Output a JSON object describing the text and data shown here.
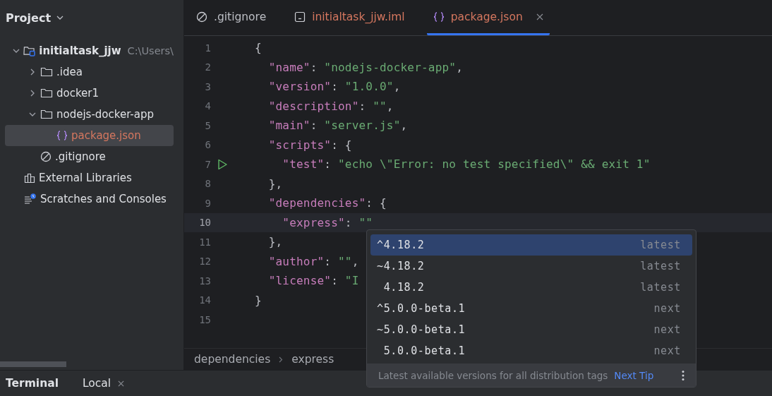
{
  "sidebar": {
    "title": "Project",
    "tree": [
      {
        "kind": "module",
        "label": "initialtask_jjw",
        "path": "C:\\Users\\",
        "expanded": true,
        "selected": false,
        "color": "#dfe1e5",
        "children": [
          {
            "kind": "folder",
            "label": ".idea",
            "expanded": false,
            "selected": false,
            "color": "#dfe1e5"
          },
          {
            "kind": "folder",
            "label": "docker1",
            "expanded": false,
            "selected": false,
            "color": "#dfe1e5"
          },
          {
            "kind": "folder",
            "label": "nodejs-docker-app",
            "expanded": true,
            "selected": false,
            "color": "#dfe1e5",
            "children": [
              {
                "kind": "json",
                "label": "package.json",
                "selected": true,
                "color": "#d5775f"
              }
            ]
          },
          {
            "kind": "ignore",
            "label": ".gitignore",
            "selected": false,
            "color": "#dfe1e5"
          }
        ]
      },
      {
        "kind": "libraries",
        "label": "External Libraries",
        "selected": false,
        "color": "#dfe1e5"
      },
      {
        "kind": "scratches",
        "label": "Scratches and Consoles",
        "selected": false,
        "color": "#dfe1e5"
      }
    ]
  },
  "tabs": [
    {
      "kind": "ignore",
      "label": ".gitignore",
      "selected": false,
      "color": "#bcbec4"
    },
    {
      "kind": "iml",
      "label": "initialtask_jjw.iml",
      "selected": false,
      "color": "#d5775f"
    },
    {
      "kind": "json",
      "label": "package.json",
      "selected": true,
      "color": "#d5775f"
    }
  ],
  "editor": {
    "lines": [
      {
        "number": "1",
        "current": false,
        "run": false,
        "tokens": [
          {
            "kind": "punct",
            "t": "{"
          }
        ]
      },
      {
        "number": "2",
        "current": false,
        "run": false,
        "tokens": [
          {
            "kind": "key",
            "t": "  \"name\""
          },
          {
            "kind": "punct",
            "t": ": "
          },
          {
            "kind": "string",
            "t": "\"nodejs-docker-app\""
          },
          {
            "kind": "punct",
            "t": ","
          }
        ]
      },
      {
        "number": "3",
        "current": false,
        "run": false,
        "tokens": [
          {
            "kind": "key",
            "t": "  \"version\""
          },
          {
            "kind": "punct",
            "t": ": "
          },
          {
            "kind": "string",
            "t": "\"1.0.0\""
          },
          {
            "kind": "punct",
            "t": ","
          }
        ]
      },
      {
        "number": "4",
        "current": false,
        "run": false,
        "tokens": [
          {
            "kind": "key",
            "t": "  \"description\""
          },
          {
            "kind": "punct",
            "t": ": "
          },
          {
            "kind": "string",
            "t": "\"\""
          },
          {
            "kind": "punct",
            "t": ","
          }
        ]
      },
      {
        "number": "5",
        "current": false,
        "run": false,
        "tokens": [
          {
            "kind": "key",
            "t": "  \"main\""
          },
          {
            "kind": "punct",
            "t": ": "
          },
          {
            "kind": "string",
            "t": "\"server.js\""
          },
          {
            "kind": "punct",
            "t": ","
          }
        ]
      },
      {
        "number": "6",
        "current": false,
        "run": false,
        "tokens": [
          {
            "kind": "key",
            "t": "  \"scripts\""
          },
          {
            "kind": "punct",
            "t": ": {"
          }
        ]
      },
      {
        "number": "7",
        "current": false,
        "run": true,
        "tokens": [
          {
            "kind": "key",
            "t": "    \"test\""
          },
          {
            "kind": "punct",
            "t": ": "
          },
          {
            "kind": "string",
            "t": "\"echo \\\"Error: no test specified\\\" && exit 1\""
          }
        ]
      },
      {
        "number": "8",
        "current": false,
        "run": false,
        "tokens": [
          {
            "kind": "punct",
            "t": "  },"
          }
        ]
      },
      {
        "number": "9",
        "current": false,
        "run": false,
        "tokens": [
          {
            "kind": "key",
            "t": "  \"dependencies\""
          },
          {
            "kind": "punct",
            "t": ": {"
          }
        ]
      },
      {
        "number": "10",
        "current": true,
        "run": false,
        "tokens": [
          {
            "kind": "key",
            "t": "    \"express\""
          },
          {
            "kind": "punct",
            "t": ": "
          },
          {
            "kind": "string",
            "t": "\"\""
          }
        ]
      },
      {
        "number": "11",
        "current": false,
        "run": false,
        "tokens": [
          {
            "kind": "punct",
            "t": "  },"
          }
        ]
      },
      {
        "number": "12",
        "current": false,
        "run": false,
        "tokens": [
          {
            "kind": "key",
            "t": "  \"author\""
          },
          {
            "kind": "punct",
            "t": ": "
          },
          {
            "kind": "string",
            "t": "\"\""
          },
          {
            "kind": "punct",
            "t": ","
          }
        ]
      },
      {
        "number": "13",
        "current": false,
        "run": false,
        "tokens": [
          {
            "kind": "key",
            "t": "  \"license\""
          },
          {
            "kind": "punct",
            "t": ": "
          },
          {
            "kind": "string",
            "t": "\"I"
          }
        ]
      },
      {
        "number": "14",
        "current": false,
        "run": false,
        "tokens": [
          {
            "kind": "punct",
            "t": "}"
          }
        ]
      },
      {
        "number": "15",
        "current": false,
        "run": false
      }
    ],
    "breadcrumbs": [
      "dependencies",
      "express"
    ]
  },
  "completion": {
    "items": [
      {
        "value": "^4.18.2",
        "tag": "latest",
        "selected": true
      },
      {
        "value": "~4.18.2",
        "tag": "latest",
        "selected": false
      },
      {
        "value": " 4.18.2",
        "tag": "latest",
        "selected": false
      },
      {
        "value": "^5.0.0-beta.1",
        "tag": "next",
        "selected": false
      },
      {
        "value": "~5.0.0-beta.1",
        "tag": "next",
        "selected": false
      },
      {
        "value": " 5.0.0-beta.1",
        "tag": "next",
        "selected": false
      }
    ],
    "hint": "Latest available versions for all distribution tags",
    "link": "Next Tip"
  },
  "bottom_panel": {
    "title": "Terminal",
    "tabs": [
      {
        "label": "Local",
        "selected": true
      }
    ]
  }
}
